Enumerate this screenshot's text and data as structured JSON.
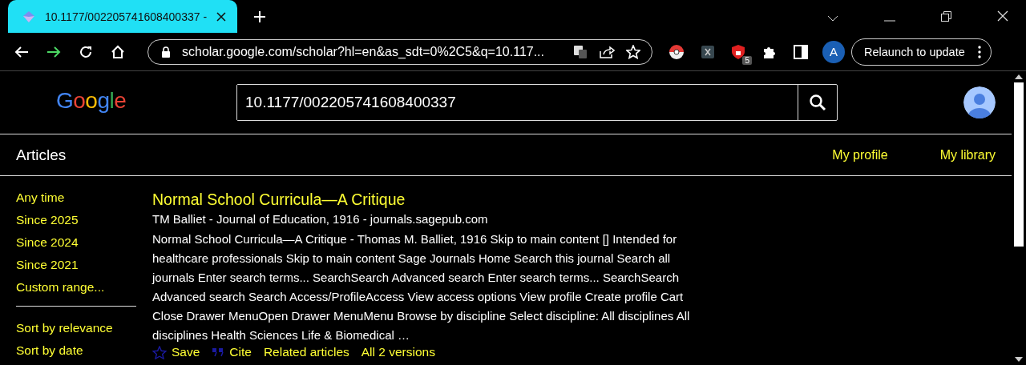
{
  "browser": {
    "tab": {
      "title": "10.1177/002205741608400337 -",
      "selected": true
    },
    "url": "scholar.google.com/scholar?hl=en&as_sdt=0%2C5&q=10.117...",
    "extension_badge": "5",
    "profile_initial": "A",
    "relaunch_button": "Relaunch to update"
  },
  "header": {
    "logo": "Google",
    "search": {
      "value": "10.1177/002205741608400337"
    }
  },
  "nav": {
    "title": "Articles",
    "links": [
      "My profile",
      "My library"
    ]
  },
  "sidebar": {
    "time_filters": [
      "Any time",
      "Since 2025",
      "Since 2024",
      "Since 2021",
      "Custom range..."
    ],
    "sort_options": [
      "Sort by relevance",
      "Sort by date"
    ]
  },
  "results": [
    {
      "title": "Normal School Curricula—A Critique",
      "meta": "TM Balliet - Journal of Education, 1916 - journals.sagepub.com",
      "snippet": "Normal School Curricula—A Critique - Thomas M. Balliet, 1916 Skip to main content [] Intended for healthcare professionals Skip to main content Sage Journals Home Search this journal Search all journals Enter search terms... SearchSearch Advanced search Enter search terms... SearchSearch Advanced search Search Access/ProfileAccess View access options View profile Create profile Cart Close Drawer MenuOpen Drawer MenuMenu Browse by discipline Select discipline: All disciplines All disciplines Health Sciences Life & Biomedical …",
      "actions": [
        {
          "kind": "save",
          "label": "Save"
        },
        {
          "kind": "cite",
          "label": "Cite"
        },
        {
          "kind": "link",
          "label": "Related articles"
        },
        {
          "kind": "link",
          "label": "All 2 versions"
        }
      ]
    }
  ]
}
